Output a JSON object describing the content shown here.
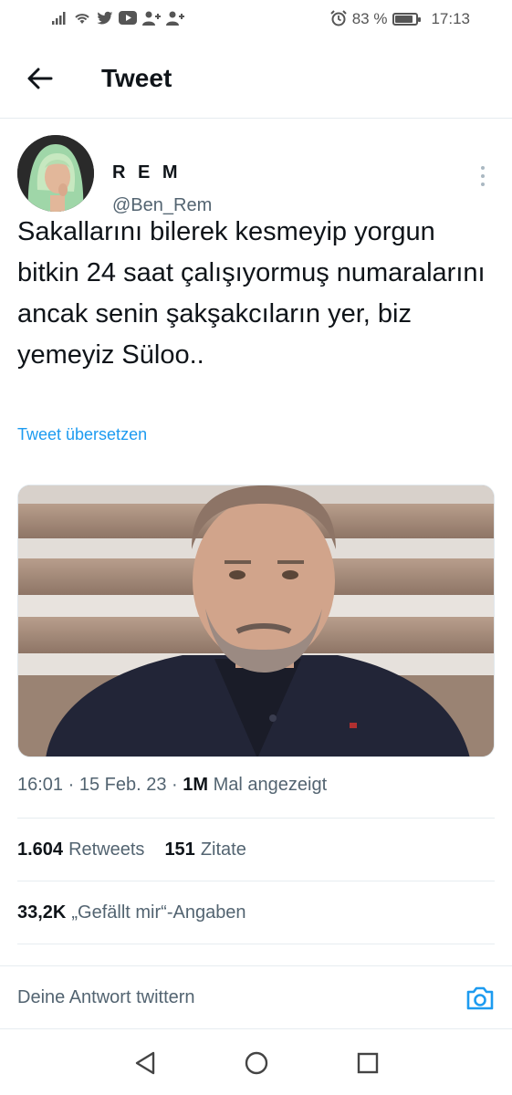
{
  "status_bar": {
    "battery_percent": "83 %",
    "battery_level": 0.83,
    "time": "17:13",
    "icons": [
      "sim-signal-icon",
      "wifi-icon",
      "twitter-icon",
      "youtube-icon",
      "user-add-icon",
      "user-add-icon",
      "alarm-icon",
      "battery-icon"
    ]
  },
  "header": {
    "title": "Tweet",
    "back_icon": "arrow-left-icon"
  },
  "tweet": {
    "author_name": "R E M",
    "author_handle": "@Ben_Rem",
    "text": "Sakallarını bilerek kesmeyip yorgun bitkin 24 saat çalışıyormuş numaralarını ancak senin şakşakcıların yer, biz yemeyiz Süloo..",
    "translate_label": "Tweet übersetzen",
    "time": "16:01",
    "date": "15 Feb. 23",
    "views_count": "1M",
    "views_label": "Mal angezeigt",
    "retweets_count": "1.604",
    "retweets_label": "Retweets",
    "quotes_count": "151",
    "quotes_label": "Zitate",
    "likes_count": "33,2K",
    "likes_label": "„Gefällt mir“-Angaben"
  },
  "reply": {
    "placeholder": "Deine Antwort twittern",
    "camera_icon": "camera-icon"
  },
  "nav": {
    "icons": [
      "back-triangle-icon",
      "home-circle-icon",
      "recents-square-icon"
    ]
  },
  "colors": {
    "accent": "#1d9bf0",
    "text_primary": "#0f1419",
    "text_secondary": "#536471",
    "divider": "#e6ecf0"
  }
}
